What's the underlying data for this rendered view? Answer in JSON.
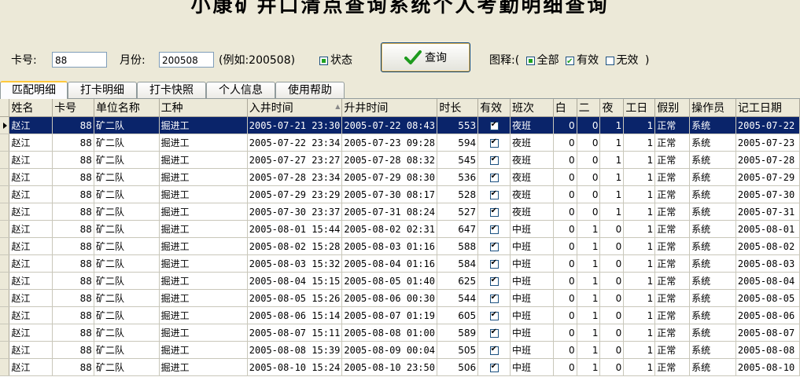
{
  "window": {
    "title": "小康矿井口清点查询系统个人考勤明细查询"
  },
  "search": {
    "card_label": "卡号:",
    "card_value": "88",
    "month_label": "月份:",
    "month_value": "200508",
    "example_text": "(例如:200508)",
    "status_label": "状态",
    "query_button": "查询"
  },
  "legend": {
    "label": "图释:(",
    "all": "全部",
    "valid": "有效",
    "invalid": "无效",
    "close": ")"
  },
  "tabs": [
    "匹配明细",
    "打卡明细",
    "打卡快照",
    "个人信息",
    "使用帮助"
  ],
  "grid": {
    "columns": [
      "姓名",
      "卡号",
      "单位名称",
      "工种",
      "入井时间",
      "升井时间",
      "时长",
      "有效",
      "班次",
      "白",
      "二",
      "夜",
      "工日",
      "假别",
      "操作员",
      "记工日期"
    ],
    "rows": [
      [
        "赵江",
        "88",
        "矿二队",
        "掘进工",
        "2005-07-21 23:30",
        "2005-07-22 08:43",
        "553",
        "夜班",
        "0",
        "0",
        "1",
        "1",
        "正常",
        "系统",
        "2005-07-22"
      ],
      [
        "赵江",
        "88",
        "矿二队",
        "掘进工",
        "2005-07-22 23:34",
        "2005-07-23 09:28",
        "594",
        "夜班",
        "0",
        "0",
        "1",
        "1",
        "正常",
        "系统",
        "2005-07-23"
      ],
      [
        "赵江",
        "88",
        "矿二队",
        "掘进工",
        "2005-07-27 23:27",
        "2005-07-28 08:32",
        "545",
        "夜班",
        "0",
        "0",
        "1",
        "1",
        "正常",
        "系统",
        "2005-07-28"
      ],
      [
        "赵江",
        "88",
        "矿二队",
        "掘进工",
        "2005-07-28 23:34",
        "2005-07-29 08:30",
        "536",
        "夜班",
        "0",
        "0",
        "1",
        "1",
        "正常",
        "系统",
        "2005-07-29"
      ],
      [
        "赵江",
        "88",
        "矿二队",
        "掘进工",
        "2005-07-29 23:29",
        "2005-07-30 08:17",
        "528",
        "夜班",
        "0",
        "0",
        "1",
        "1",
        "正常",
        "系统",
        "2005-07-30"
      ],
      [
        "赵江",
        "88",
        "矿二队",
        "掘进工",
        "2005-07-30 23:37",
        "2005-07-31 08:24",
        "527",
        "夜班",
        "0",
        "0",
        "1",
        "1",
        "正常",
        "系统",
        "2005-07-31"
      ],
      [
        "赵江",
        "88",
        "矿二队",
        "掘进工",
        "2005-08-01 15:44",
        "2005-08-02 02:31",
        "647",
        "中班",
        "0",
        "1",
        "0",
        "1",
        "正常",
        "系统",
        "2005-08-01"
      ],
      [
        "赵江",
        "88",
        "矿二队",
        "掘进工",
        "2005-08-02 15:28",
        "2005-08-03 01:16",
        "588",
        "中班",
        "0",
        "1",
        "0",
        "1",
        "正常",
        "系统",
        "2005-08-02"
      ],
      [
        "赵江",
        "88",
        "矿二队",
        "掘进工",
        "2005-08-03 15:32",
        "2005-08-04 01:16",
        "584",
        "中班",
        "0",
        "1",
        "0",
        "1",
        "正常",
        "系统",
        "2005-08-03"
      ],
      [
        "赵江",
        "88",
        "矿二队",
        "掘进工",
        "2005-08-04 15:15",
        "2005-08-05 01:40",
        "625",
        "中班",
        "0",
        "1",
        "0",
        "1",
        "正常",
        "系统",
        "2005-08-04"
      ],
      [
        "赵江",
        "88",
        "矿二队",
        "掘进工",
        "2005-08-05 15:26",
        "2005-08-06 00:30",
        "544",
        "中班",
        "0",
        "1",
        "0",
        "1",
        "正常",
        "系统",
        "2005-08-05"
      ],
      [
        "赵江",
        "88",
        "矿二队",
        "掘进工",
        "2005-08-06 15:14",
        "2005-08-07 01:19",
        "605",
        "中班",
        "0",
        "1",
        "0",
        "1",
        "正常",
        "系统",
        "2005-08-06"
      ],
      [
        "赵江",
        "88",
        "矿二队",
        "掘进工",
        "2005-08-07 15:11",
        "2005-08-08 01:00",
        "589",
        "中班",
        "0",
        "1",
        "0",
        "1",
        "正常",
        "系统",
        "2005-08-07"
      ],
      [
        "赵江",
        "88",
        "矿二队",
        "掘进工",
        "2005-08-08 15:39",
        "2005-08-09 00:04",
        "505",
        "中班",
        "0",
        "1",
        "0",
        "1",
        "正常",
        "系统",
        "2005-08-08"
      ],
      [
        "赵江",
        "88",
        "矿二队",
        "掘进工",
        "2005-08-10 15:24",
        "2005-08-10 23:50",
        "506",
        "中班",
        "0",
        "1",
        "0",
        "1",
        "正常",
        "系统",
        "2005-08-10"
      ]
    ]
  },
  "colors": {
    "selected_row": "#0A246A",
    "valid_check": "#21A121",
    "window_bg": "#ECE9D8"
  }
}
